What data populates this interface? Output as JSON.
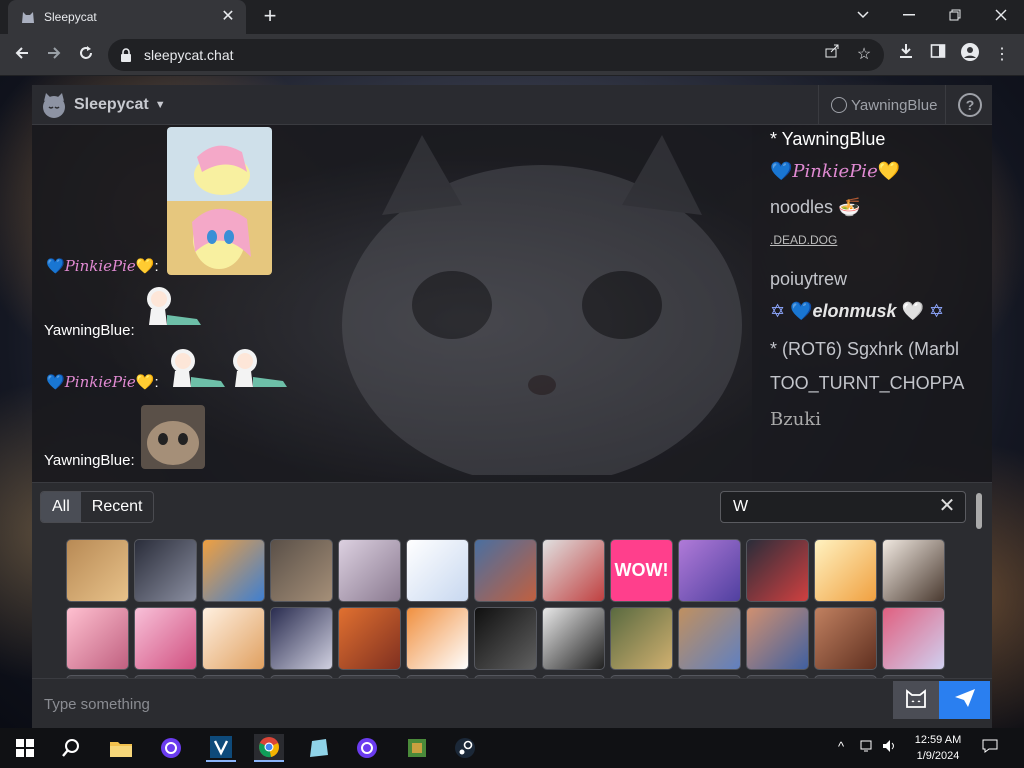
{
  "browser": {
    "tab_title": "Sleepycat",
    "url": "sleepycat.chat",
    "new_tab": "+",
    "tab_close": "✕"
  },
  "app": {
    "brand": "Sleepycat",
    "user": "YawningBlue",
    "help": "?"
  },
  "messages": [
    {
      "author": "PinkiePie",
      "sep": ":",
      "content": "fluttershy-emote"
    },
    {
      "author": "YawningBlue",
      "sep": ":",
      "content": "chibi-emote"
    },
    {
      "author": "PinkiePie",
      "sep": ":",
      "content": "chibi-emote-x2"
    },
    {
      "author": "YawningBlue",
      "sep": ":",
      "content": "cat-emote"
    }
  ],
  "userlist": [
    {
      "name": "* YawningBlue"
    },
    {
      "name": "PinkiePie"
    },
    {
      "name": "noodles 🍜"
    },
    {
      "name": ".DEAD.DOG"
    },
    {
      "name": "poiuytrew"
    },
    {
      "name": "elonmusk"
    },
    {
      "name": " * (ROT6) Sgxhrk (Marbl"
    },
    {
      "name": "TOO_TURNT_CHOPPA"
    },
    {
      "name": "Bzuki"
    }
  ],
  "picker": {
    "tab_all": "All",
    "tab_recent": "Recent",
    "search_value": "W",
    "clear": "✕"
  },
  "composer": {
    "placeholder": "Type something"
  },
  "taskbar": {
    "time": "12:59 AM",
    "date": "1/9/2024"
  }
}
